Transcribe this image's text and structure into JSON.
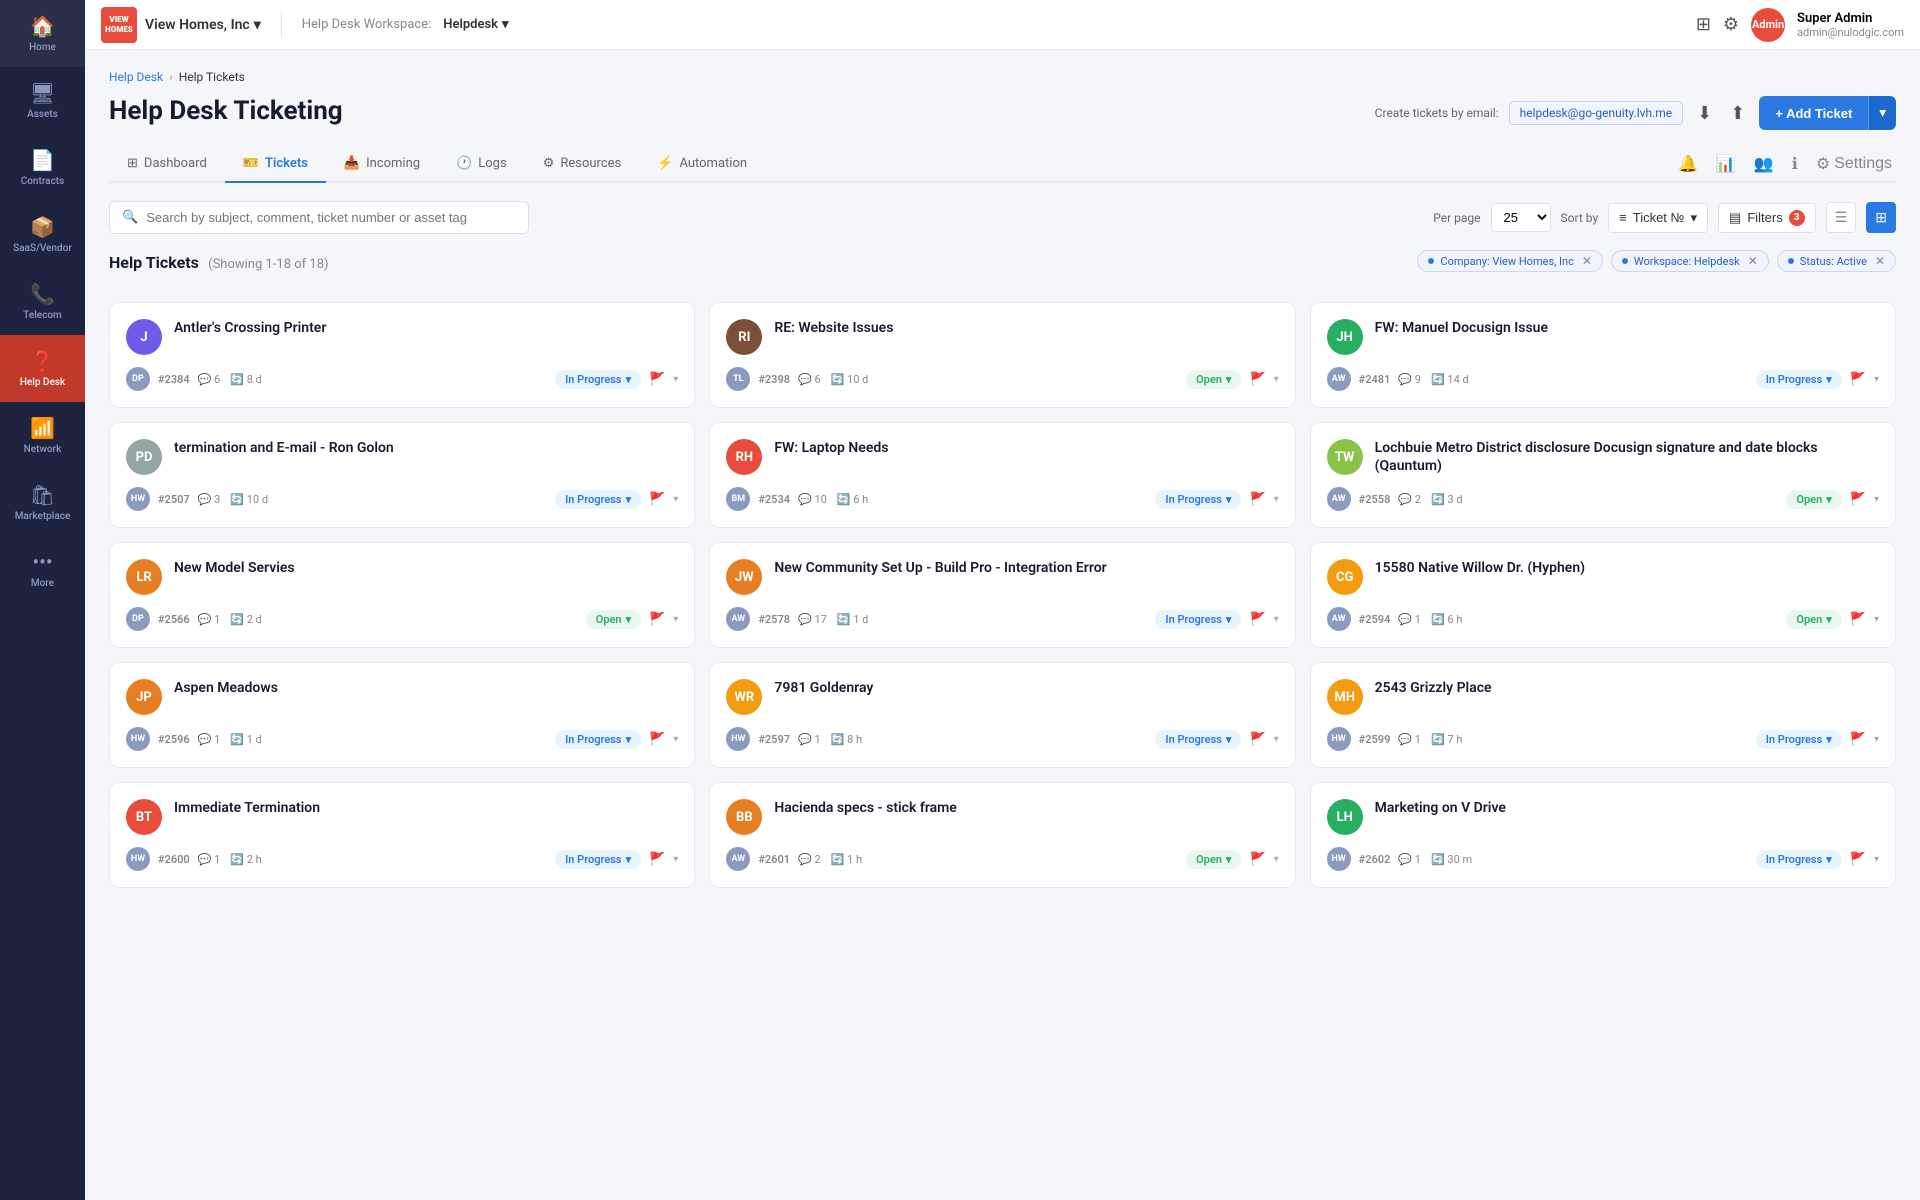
{
  "app": {
    "logo_text": "VIEW\nHOMES",
    "company": "View Homes, Inc",
    "workspace_label": "Help Desk Workspace:",
    "workspace_name": "Helpdesk"
  },
  "user": {
    "name": "Super Admin",
    "email": "admin@nulodgic.com",
    "avatar": "Admin"
  },
  "sidebar": {
    "items": [
      {
        "id": "home",
        "label": "Home",
        "icon": "🏠"
      },
      {
        "id": "assets",
        "label": "Assets",
        "icon": "🖥"
      },
      {
        "id": "contracts",
        "label": "Contracts",
        "icon": "📄"
      },
      {
        "id": "saas-vendor",
        "label": "SaaS/Vendor",
        "icon": "📦"
      },
      {
        "id": "telecom",
        "label": "Telecom",
        "icon": "📞"
      },
      {
        "id": "help-desk",
        "label": "Help Desk",
        "icon": "❓",
        "active": true
      },
      {
        "id": "network",
        "label": "Network",
        "icon": "📶"
      },
      {
        "id": "marketplace",
        "label": "Marketplace",
        "icon": "🛍"
      },
      {
        "id": "more",
        "label": "More",
        "icon": "•••"
      }
    ]
  },
  "breadcrumb": {
    "items": [
      "Help Desk",
      "Help Tickets"
    ]
  },
  "page": {
    "title": "Help Desk Ticketing",
    "email_label": "Create tickets by email:",
    "email_value": "helpdesk@go-genuity.lvh.me",
    "add_ticket_label": "+ Add Ticket"
  },
  "tabs": {
    "items": [
      {
        "id": "dashboard",
        "label": "Dashboard",
        "icon": "⊞"
      },
      {
        "id": "tickets",
        "label": "Tickets",
        "icon": "🎫",
        "active": true
      },
      {
        "id": "incoming",
        "label": "Incoming",
        "icon": "📥"
      },
      {
        "id": "logs",
        "label": "Logs",
        "icon": "🕐"
      },
      {
        "id": "resources",
        "label": "Resources",
        "icon": "⚙"
      },
      {
        "id": "automation",
        "label": "Automation",
        "icon": "⚡"
      }
    ],
    "settings_label": "Settings"
  },
  "toolbar": {
    "search_placeholder": "Search by subject, comment, ticket number or asset tag",
    "per_page_label": "Per page",
    "per_page_value": "25",
    "sort_by_label": "Sort by",
    "sort_by_value": "Ticket №",
    "filters_label": "Filters",
    "filters_count": "3"
  },
  "filter_tags": [
    {
      "label": "Company: View Homes, Inc"
    },
    {
      "label": "Workspace: Helpdesk"
    },
    {
      "label": "Status: Active"
    }
  ],
  "section": {
    "title": "Help Tickets",
    "count": "(Showing 1-18 of 18)"
  },
  "tickets": [
    {
      "id": "t1",
      "avatar_initials": "J",
      "avatar_color": "av-purple",
      "title": "Antler's Crossing Printer",
      "meta_avatar": "DP",
      "ticket_num": "#2384",
      "comments": "6",
      "time": "8 d",
      "status": "In Progress",
      "status_class": "status-in-progress"
    },
    {
      "id": "t2",
      "avatar_initials": "RI",
      "avatar_color": "av-brown",
      "title": "RE: Website Issues",
      "meta_avatar": "TL",
      "ticket_num": "#2398",
      "comments": "6",
      "time": "10 d",
      "status": "Open",
      "status_class": "status-open"
    },
    {
      "id": "t3",
      "avatar_initials": "JH",
      "avatar_color": "av-green",
      "title": "FW: Manuel Docusign Issue",
      "meta_avatar": "AW",
      "ticket_num": "#2481",
      "comments": "9",
      "time": "14 d",
      "status": "In Progress",
      "status_class": "status-in-progress"
    },
    {
      "id": "t4",
      "avatar_initials": "PD",
      "avatar_color": "av-gray",
      "title": "termination and E-mail - Ron Golon",
      "meta_avatar": "HW",
      "ticket_num": "#2507",
      "comments": "3",
      "time": "10 d",
      "status": "In Progress",
      "status_class": "status-in-progress"
    },
    {
      "id": "t5",
      "avatar_initials": "RH",
      "avatar_color": "av-red",
      "title": "FW: Laptop Needs",
      "meta_avatar": "BM",
      "ticket_num": "#2534",
      "comments": "10",
      "time": "6 h",
      "status": "In Progress",
      "status_class": "status-in-progress"
    },
    {
      "id": "t6",
      "avatar_initials": "TW",
      "avatar_color": "av-lime",
      "title": "Lochbuie Metro District disclosure Docusign signature and date blocks (Qauntum)",
      "meta_avatar": "AW",
      "ticket_num": "#2558",
      "comments": "2",
      "time": "3 d",
      "status": "Open",
      "status_class": "status-open"
    },
    {
      "id": "t7",
      "avatar_initials": "LR",
      "avatar_color": "av-orange",
      "title": "New Model Servies",
      "meta_avatar": "DP",
      "ticket_num": "#2566",
      "comments": "1",
      "time": "2 d",
      "status": "Open",
      "status_class": "status-open"
    },
    {
      "id": "t8",
      "avatar_initials": "JW",
      "avatar_color": "av-orange",
      "title": "New Community Set Up - Build Pro - Integration Error",
      "meta_avatar": "AW",
      "ticket_num": "#2578",
      "comments": "17",
      "time": "1 d",
      "status": "In Progress",
      "status_class": "status-in-progress"
    },
    {
      "id": "t9",
      "avatar_initials": "CG",
      "avatar_color": "av-yellow",
      "title": "15580 Native Willow Dr. (Hyphen)",
      "meta_avatar": "AW",
      "ticket_num": "#2594",
      "comments": "1",
      "time": "6 h",
      "status": "Open",
      "status_class": "status-open"
    },
    {
      "id": "t10",
      "avatar_initials": "JP",
      "avatar_color": "av-orange",
      "title": "Aspen Meadows",
      "meta_avatar": "HW",
      "ticket_num": "#2596",
      "comments": "1",
      "time": "1 d",
      "status": "In Progress",
      "status_class": "status-in-progress"
    },
    {
      "id": "t11",
      "avatar_initials": "WR",
      "avatar_color": "av-yellow",
      "title": "7981 Goldenray",
      "meta_avatar": "HW",
      "ticket_num": "#2597",
      "comments": "1",
      "time": "8 h",
      "status": "In Progress",
      "status_class": "status-in-progress"
    },
    {
      "id": "t12",
      "avatar_initials": "MH",
      "avatar_color": "av-yellow",
      "title": "2543 Grizzly Place",
      "meta_avatar": "HW",
      "ticket_num": "#2599",
      "comments": "1",
      "time": "7 h",
      "status": "In Progress",
      "status_class": "status-in-progress"
    },
    {
      "id": "t13",
      "avatar_initials": "BT",
      "avatar_color": "av-red",
      "title": "Immediate Termination",
      "meta_avatar": "HW",
      "ticket_num": "#2600",
      "comments": "1",
      "time": "2 h",
      "status": "In Progress",
      "status_class": "status-in-progress"
    },
    {
      "id": "t14",
      "avatar_initials": "BB",
      "avatar_color": "av-orange",
      "title": "Hacienda specs - stick frame",
      "meta_avatar": "AW",
      "ticket_num": "#2601",
      "comments": "2",
      "time": "1 h",
      "status": "Open",
      "status_class": "status-open"
    },
    {
      "id": "t15",
      "avatar_initials": "LH",
      "avatar_color": "av-green",
      "title": "Marketing on V Drive",
      "meta_avatar": "HW",
      "ticket_num": "#2602",
      "comments": "1",
      "time": "30 m",
      "status": "In Progress",
      "status_class": "status-in-progress"
    }
  ]
}
